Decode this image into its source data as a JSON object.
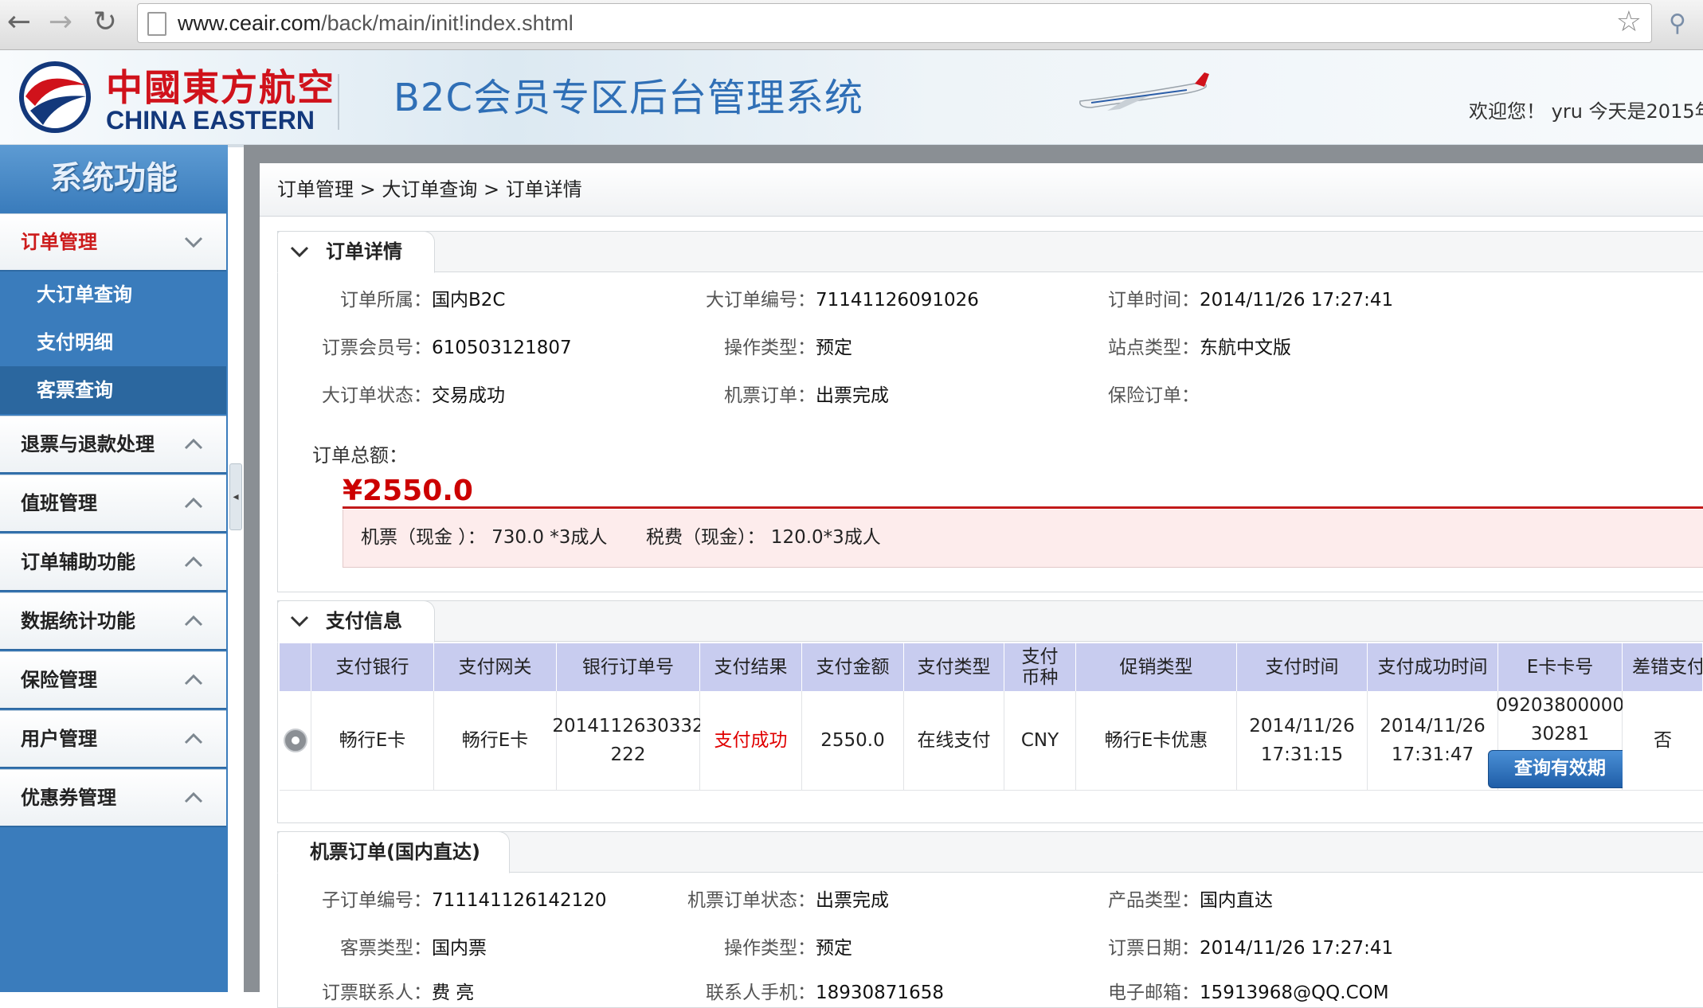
{
  "browser": {
    "url_host": "www.ceair.com",
    "url_path": "/back/main/init!index.shtml"
  },
  "header": {
    "logo_cn": "中國東方航空",
    "logo_en": "CHINA EASTERN",
    "system_title": "B2C会员专区后台管理系统",
    "welcome": "欢迎您！ yru 今天是2015年"
  },
  "sidebar": {
    "title": "系统功能",
    "menus": [
      {
        "label": "订单管理",
        "expanded": true,
        "active": true
      },
      {
        "label": "退票与退款处理"
      },
      {
        "label": "值班管理"
      },
      {
        "label": "订单辅助功能"
      },
      {
        "label": "数据统计功能"
      },
      {
        "label": "保险管理"
      },
      {
        "label": "用户管理"
      },
      {
        "label": "优惠券管理"
      }
    ],
    "submenu": [
      "大订单查询",
      "支付明细",
      "客票查询"
    ]
  },
  "breadcrumb": "订单管理 > 大订单查询 > 订单详情",
  "order_detail": {
    "tab": "订单详情",
    "fields": {
      "owner_label": "订单所属：",
      "owner": "国内B2C",
      "order_no_label": "大订单编号：",
      "order_no": "71141126091026",
      "order_time_label": "订单时间：",
      "order_time": "2014/11/26 17:27:41",
      "member_label": "订票会员号：",
      "member": "610503121807",
      "op_type_label": "操作类型：",
      "op_type": "预定",
      "site_label": "站点类型：",
      "site": "东航中文版",
      "status_label": "大订单状态：",
      "status": "交易成功",
      "ticket_order_label": "机票订单：",
      "ticket_order": "出票完成",
      "insurance_label": "保险订单：",
      "insurance": ""
    },
    "total_label": "订单总额：",
    "total_amount": "¥2550.0",
    "ticket_cash": "机票（现金 ）：  730.0 *3成人",
    "tax_cash": "税费（现金）：  120.0*3成人"
  },
  "payment": {
    "tab": "支付信息",
    "columns": [
      "支付银行",
      "支付网关",
      "银行订单号",
      "支付结果",
      "支付金额",
      "支付类型",
      "支付币种",
      "促销类型",
      "支付时间",
      "支付成功时间",
      "E卡卡号",
      "差错支付"
    ],
    "row": {
      "bank": "畅行E卡",
      "gateway": "畅行E卡",
      "bank_order_1": "2014112630332",
      "bank_order_2": "222",
      "result": "支付成功",
      "amount": "2550.0",
      "type": "在线支付",
      "currency": "CNY",
      "promo": "畅行E卡优惠",
      "pay_date": "2014/11/26",
      "pay_time": "17:31:15",
      "success_date": "2014/11/26",
      "success_time": "17:31:47",
      "card_1": "09203800000",
      "card_2": "30281",
      "error": "否",
      "button": "查询有效期"
    },
    "result_color": "#e00000"
  },
  "ticket_order": {
    "tab": "机票订单(国内直达)",
    "fields": {
      "sub_no_label": "子订单编号：",
      "sub_no": "711141126142120",
      "ticket_status_label": "机票订单状态：",
      "ticket_status": "出票完成",
      "product_label": "产品类型：",
      "product": "国内直达",
      "passenger_label": "客票类型：",
      "passenger": "国内票",
      "op_type_label": "操作类型：",
      "op_type": "预定",
      "date_label": "订票日期：",
      "date": "2014/11/26 17:27:41",
      "contact_label": "订票联系人：",
      "contact": "费 亮",
      "phone_label": "联系人手机：",
      "phone": "18930871658",
      "email_label": "电子邮箱：",
      "email": "15913968@QQ.COM"
    }
  },
  "colors": {
    "brand_red": "#d0121b",
    "brand_blue": "#13387b",
    "sidebar": "#3a7cbc",
    "amount_red": "#cc0000"
  }
}
